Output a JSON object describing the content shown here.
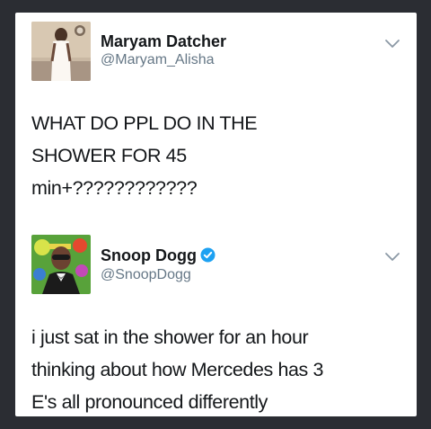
{
  "tweets": [
    {
      "name": "Maryam Datcher",
      "handle": "@Maryam_Alisha",
      "verified": false,
      "avatar": "profile-photo",
      "menu_icon": "chevron-down-icon",
      "text_lines": [
        "WHAT DO PPL DO IN THE",
        "SHOWER FOR 45",
        "min+????????????"
      ]
    },
    {
      "name": "Snoop Dogg",
      "handle": "@SnoopDogg",
      "verified": true,
      "avatar": "profile-photo",
      "menu_icon": "chevron-down-icon",
      "text_lines": [
        "i just sat in the shower for an hour",
        "thinking about how Mercedes has 3",
        "E's all pronounced differently"
      ]
    }
  ],
  "colors": {
    "background": "#2b2d33",
    "card": "#ffffff",
    "text": "#14171a",
    "handle": "#657786",
    "verified_badge": "#1da1f2"
  }
}
